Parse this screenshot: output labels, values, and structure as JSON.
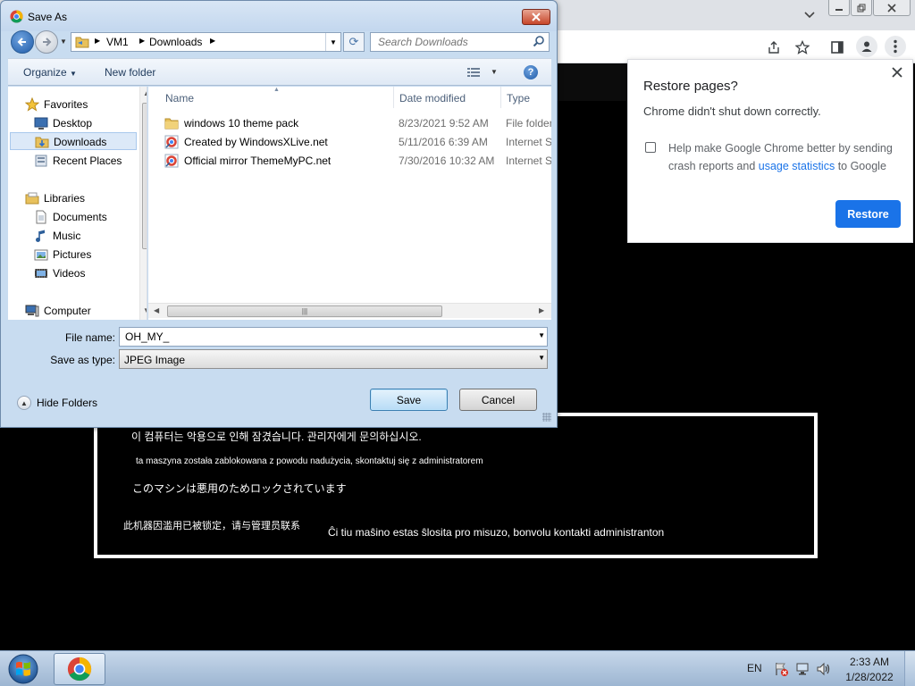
{
  "dialog": {
    "title": "Save As",
    "breadcrumb": [
      "VM1",
      "Downloads"
    ],
    "search_placeholder": "Search Downloads",
    "toolbar": {
      "organize": "Organize",
      "new_folder": "New folder"
    },
    "nav": {
      "favorites": "Favorites",
      "desktop": "Desktop",
      "downloads": "Downloads",
      "recent_places": "Recent Places",
      "libraries": "Libraries",
      "documents": "Documents",
      "music": "Music",
      "pictures": "Pictures",
      "videos": "Videos",
      "computer": "Computer"
    },
    "columns": {
      "name": "Name",
      "date_modified": "Date modified",
      "type": "Type"
    },
    "files": [
      {
        "name": "windows 10 theme pack",
        "date": "8/23/2021 9:52 AM",
        "type": "File folder",
        "icon": "folder-icon"
      },
      {
        "name": "Created by WindowsXLive.net",
        "date": "5/11/2016 6:39 AM",
        "type": "Internet Shortcut",
        "icon": "internet-shortcut-icon"
      },
      {
        "name": "Official mirror ThemeMyPC.net",
        "date": "7/30/2016 10:32 AM",
        "type": "Internet Shortcut",
        "icon": "internet-shortcut-icon"
      }
    ],
    "file_name_label": "File name:",
    "file_name_value": "OH_MY_",
    "save_type_label": "Save as type:",
    "save_type_value": "JPEG Image",
    "hide_folders": "Hide Folders",
    "save_button": "Save",
    "cancel_button": "Cancel"
  },
  "restore_popup": {
    "title": "Restore pages?",
    "message": "Chrome didn't shut down correctly.",
    "help_text_pre": "Help make Google Chrome better by sending crash reports and ",
    "help_link": "usage statistics",
    "help_text_post": " to Google",
    "button": "Restore",
    "accent_color": "#1a73e8"
  },
  "ransom_lines": {
    "korean": "이 컴퓨터는 악용으로 인해 잠겼습니다. 관리자에게 문의하십시오.",
    "polish": "ta maszyna została zablokowana z powodu nadużycia, skontaktuj się z administratorem",
    "japanese": "このマシンは悪用のためロックされています",
    "chinese": "此机器因滥用已被锁定，请与管理员联系",
    "esperanto": "Ĉi tiu maŝino estas ŝlosita pro misuzo, bonvolu kontakti administranton"
  },
  "taskbar": {
    "language": "EN",
    "time": "2:33 AM",
    "date": "1/28/2022"
  }
}
